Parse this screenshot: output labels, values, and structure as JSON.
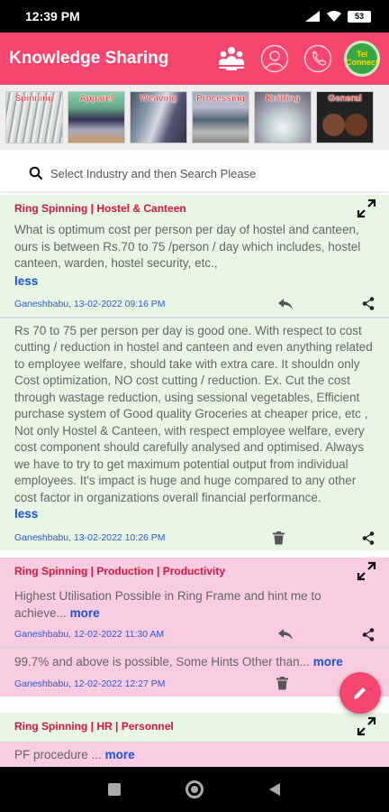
{
  "status": {
    "time": "12:39 PM",
    "battery": "53"
  },
  "app": {
    "title": "Knowledge Sharing",
    "telegram_label": "Tel\nConnect"
  },
  "industries": [
    {
      "label": "Spinning"
    },
    {
      "label": "Apparel"
    },
    {
      "label": "Weaving"
    },
    {
      "label": "Processing"
    },
    {
      "label": "Knitting"
    },
    {
      "label": "General"
    }
  ],
  "search": {
    "placeholder": "Select Industry and then Search Please"
  },
  "posts": [
    {
      "category": "Ring Spinning | Hostel & Canteen",
      "question": "What is optimum cost per person per day of hostel and canteen, ours is between Rs.70 to 75 /person / day which includes, hostel canteen, warden, hostel security, etc.,",
      "question_toggle": "less",
      "question_meta": "Ganeshbabu, 13-02-2022 09:16 PM",
      "answer": "Rs 70 to 75 per person per day is good one. With respect to cost cutting / reduction in hostel and canteen and even anything related to employee welfare, should take with extra care. It shouldn only Cost optimization, NO cost cutting / reduction. Ex. Cut the cost through wastage reduction, using sessional vegetables, Efficient purchase system of Good quality Groceries at cheaper price, etc , Not only Hostel & Canteen, with respect employee welfare, every cost component should carefully analysed and optimised. Always we have to try to get maximum potential output from individual employees. It's impact is huge and huge compared to any other cost factor in organizations overall financial performance.",
      "answer_toggle": "less",
      "answer_meta": "Ganeshbabu, 13-02-2022 10:26 PM"
    },
    {
      "category": "Ring Spinning | Production | Productivity",
      "question": "Highest Utilisation Possible in Ring Frame and hint me to achieve...",
      "question_toggle": "more",
      "question_meta": "Ganeshbabu, 12-02-2022 11:30 AM",
      "answer": "99.7% and above is possible, Some Hints Other than...",
      "answer_toggle": "more",
      "answer_meta": "Ganeshbabu, 12-02-2022 12:27 PM"
    },
    {
      "category": "Ring Spinning | HR | Personnel",
      "question": "PF procedure ...",
      "question_toggle": "more"
    }
  ],
  "colors": {
    "accent": "#f6466f",
    "link": "#1a52d8",
    "category": "#d6163e",
    "card_green": "#e8f6e4",
    "card_pink": "#f9cce1"
  }
}
